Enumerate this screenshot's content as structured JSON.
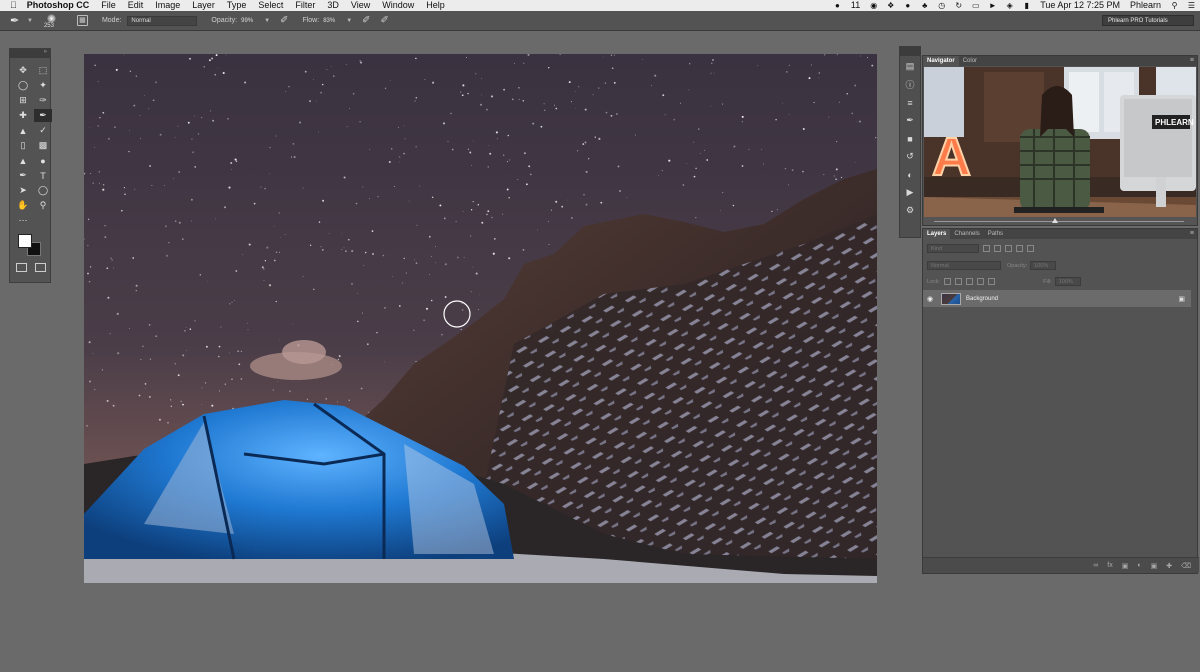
{
  "menubar": {
    "app": "Photoshop CC",
    "items": [
      "File",
      "Edit",
      "Image",
      "Layer",
      "Type",
      "Select",
      "Filter",
      "3D",
      "View",
      "Window",
      "Help"
    ],
    "badge": "11",
    "datetime": "Tue Apr 12  7:25 PM",
    "user": "Phlearn"
  },
  "options": {
    "brush_size": "253",
    "mode_label": "Mode:",
    "mode_value": "Normal",
    "opacity_label": "Opacity:",
    "opacity_value": "99%",
    "flow_label": "Flow:",
    "flow_value": "83%",
    "workspace": "Phlearn PRO Tutorials"
  },
  "tools": [
    "move-tool",
    "marquee-tool",
    "lasso-tool",
    "magic-wand-tool",
    "crop-tool",
    "eyedropper-tool",
    "healing-tool",
    "brush-tool",
    "stamp-tool",
    "history-brush-tool",
    "eraser-tool",
    "gradient-tool",
    "blur-tool",
    "dodge-tool",
    "pen-tool",
    "type-tool",
    "path-select-tool",
    "shape-tool",
    "hand-tool",
    "zoom-tool"
  ],
  "active_tool": "brush-tool",
  "navigator": {
    "tabs": [
      "Navigator",
      "Color"
    ],
    "active": "Navigator",
    "sign": "PHLEARN",
    "letter": "A"
  },
  "layers": {
    "tabs": [
      "Layers",
      "Channels",
      "Paths"
    ],
    "active": "Layers",
    "kind_placeholder": "Kind",
    "blend_mode": "Normal",
    "opacity_label": "Opacity:",
    "opacity_value": "100%",
    "lock_label": "Lock:",
    "fill_label": "Fill:",
    "fill_value": "100%",
    "layer_name": "Background"
  },
  "colors": {
    "panel": "#535353",
    "tent": "#1f78d1",
    "sky": "#3d3340"
  }
}
